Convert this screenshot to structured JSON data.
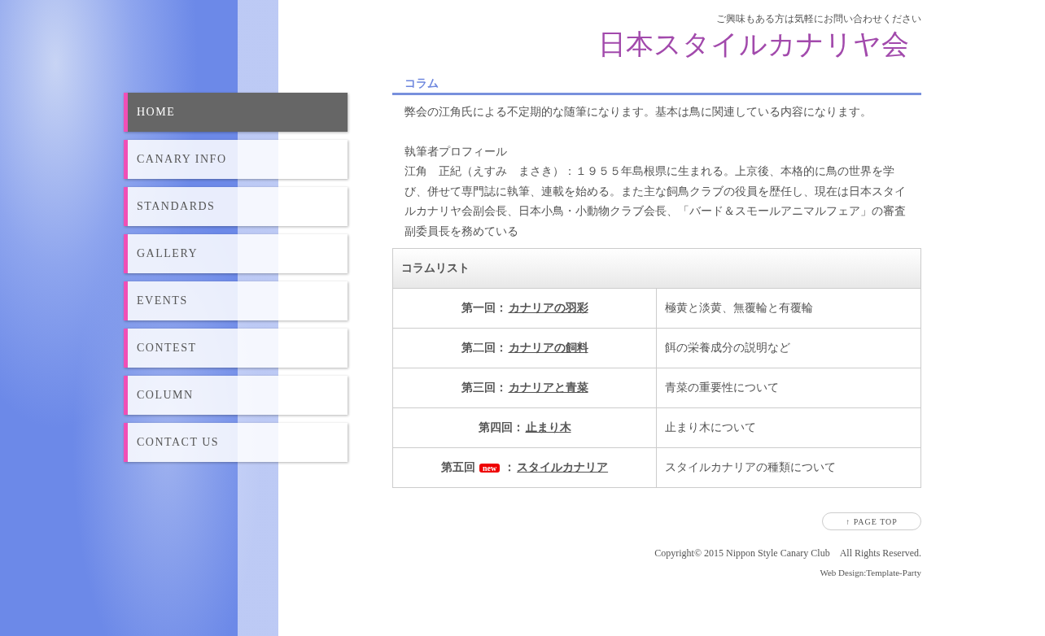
{
  "nav": [
    {
      "label": "HOME",
      "selected": true
    },
    {
      "label": "CANARY INFO",
      "selected": false
    },
    {
      "label": "STANDARDS",
      "selected": false
    },
    {
      "label": "GALLERY",
      "selected": false
    },
    {
      "label": "EVENTS",
      "selected": false
    },
    {
      "label": "CONTEST",
      "selected": false
    },
    {
      "label": "COLUMN",
      "selected": false
    },
    {
      "label": "CONTACT US",
      "selected": false
    }
  ],
  "header": {
    "tagline": "ご興味もある方は気軽にお問い合わせください",
    "logo": "日本スタイルカナリヤ会"
  },
  "section": {
    "title": "コラム",
    "intro": "弊会の江角氏による不定期的な随筆になります。基本は鳥に関連している内容になります。",
    "profile_heading": "執筆者プロフィール",
    "profile": "江角　正紀（えすみ　まさき）：１９５５年島根県に生まれる。上京後、本格的に鳥の世界を学び、併せて専門誌に執筆、連載を始める。また主な飼鳥クラブの役員を歴任し、現在は日本スタイルカナリヤ会副会長、日本小鳥・小動物クラブ会長、「バード＆スモールアニマルフェア」の審査副委員長を務めている"
  },
  "table": {
    "title": "コラムリスト",
    "rows": [
      {
        "prefix": "第一回：",
        "title": "カナリアの羽彩",
        "description": "極黄と淡黄、無覆輪と有覆輪"
      },
      {
        "prefix": "第二回：",
        "title": "カナリアの飼料",
        "description": "餌の栄養成分の説明など"
      },
      {
        "prefix": "第三回：",
        "title": "カナリアと青菜",
        "description": "青菜の重要性について"
      },
      {
        "prefix": "第四回：",
        "title": "止まり木",
        "description": "止まり木について"
      },
      {
        "prefix": "第五回",
        "badge": "new",
        "separator": "：",
        "title": "スタイルカナリア",
        "description": "スタイルカナリアの種類について"
      }
    ]
  },
  "page_top": "↑ PAGE TOP",
  "footer": {
    "copyright": "Copyright© 2015 Nippon Style Canary Club　All Rights Reserved.",
    "credit": "Web Design:Template-Party"
  }
}
